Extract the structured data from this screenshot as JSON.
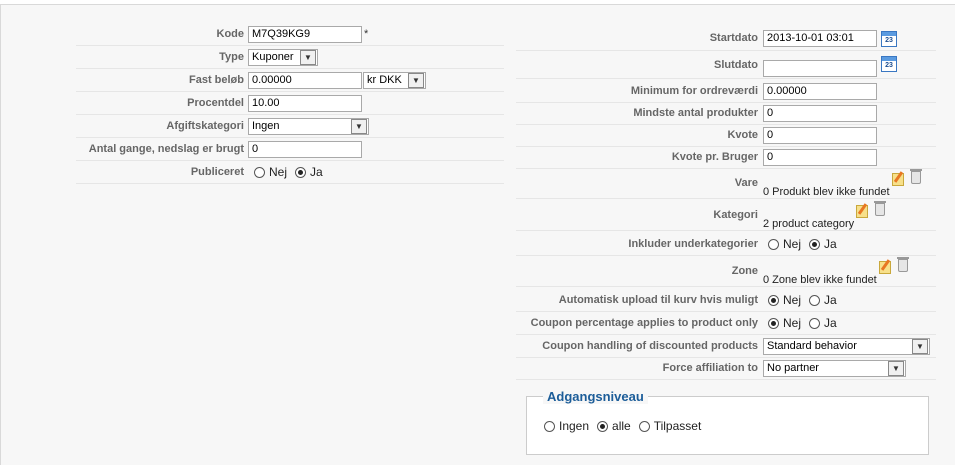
{
  "left": {
    "kode": {
      "label": "Kode",
      "value": "M7Q39KG9",
      "required_mark": "*"
    },
    "type": {
      "label": "Type",
      "value": "Kuponer"
    },
    "fast_belob": {
      "label": "Fast beløb",
      "value": "0.00000",
      "currency": "kr DKK"
    },
    "procentdel": {
      "label": "Procentdel",
      "value": "10.00"
    },
    "afgiftskategori": {
      "label": "Afgiftskategori",
      "value": "Ingen"
    },
    "antal_gange": {
      "label": "Antal gange, nedslag er brugt",
      "value": "0"
    },
    "publiceret": {
      "label": "Publiceret",
      "options": [
        "Nej",
        "Ja"
      ],
      "selected": "Ja"
    }
  },
  "right": {
    "startdato": {
      "label": "Startdato",
      "value": "2013-10-01 03:01"
    },
    "slutdato": {
      "label": "Slutdato",
      "value": ""
    },
    "minimum": {
      "label": "Minimum for ordreværdi",
      "value": "0.00000"
    },
    "mindste": {
      "label": "Mindste antal produkter",
      "value": "0"
    },
    "kvote": {
      "label": "Kvote",
      "value": "0"
    },
    "kvote_bruger": {
      "label": "Kvote pr. Bruger",
      "value": "0"
    },
    "vare": {
      "label": "Vare",
      "text": "0 Produkt blev ikke fundet"
    },
    "kategori": {
      "label": "Kategori",
      "text": "2 product category"
    },
    "inkluder": {
      "label": "Inkluder underkategorier",
      "options": [
        "Nej",
        "Ja"
      ],
      "selected": "Ja"
    },
    "zone": {
      "label": "Zone",
      "text": "0 Zone blev ikke fundet"
    },
    "auto_upload": {
      "label": "Automatisk upload til kurv hvis muligt",
      "options": [
        "Nej",
        "Ja"
      ],
      "selected": "Nej"
    },
    "coupon_pct": {
      "label": "Coupon percentage applies to product only",
      "options": [
        "Nej",
        "Ja"
      ],
      "selected": "Nej"
    },
    "coupon_handling": {
      "label": "Coupon handling of discounted products",
      "value": "Standard behavior"
    },
    "force_aff": {
      "label": "Force affiliation to",
      "value": "No partner"
    }
  },
  "access": {
    "legend": "Adgangsniveau",
    "options": [
      "Ingen",
      "alle",
      "Tilpasset"
    ],
    "selected": "alle"
  },
  "icons": {
    "calendar": "calendar-icon",
    "edit": "edit-icon",
    "delete": "trash-icon"
  }
}
